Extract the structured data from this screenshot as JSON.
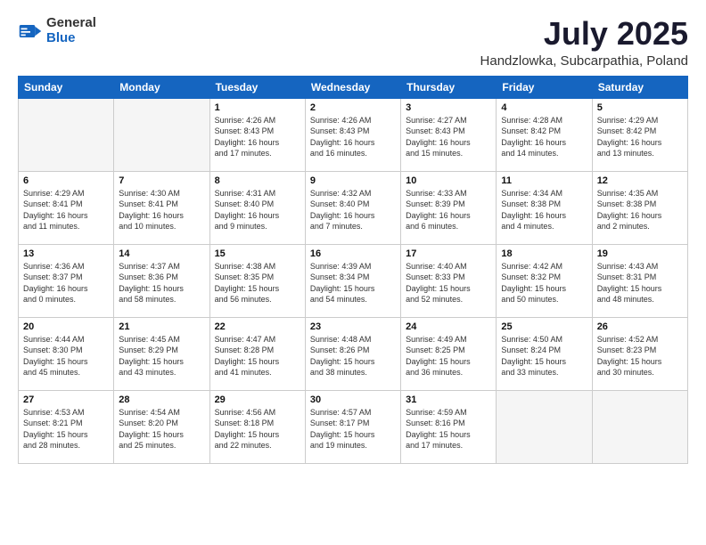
{
  "logo": {
    "general": "General",
    "blue": "Blue"
  },
  "title": "July 2025",
  "subtitle": "Handzlowka, Subcarpathia, Poland",
  "weekdays": [
    "Sunday",
    "Monday",
    "Tuesday",
    "Wednesday",
    "Thursday",
    "Friday",
    "Saturday"
  ],
  "weeks": [
    [
      {
        "day": "",
        "info": ""
      },
      {
        "day": "",
        "info": ""
      },
      {
        "day": "1",
        "info": "Sunrise: 4:26 AM\nSunset: 8:43 PM\nDaylight: 16 hours\nand 17 minutes."
      },
      {
        "day": "2",
        "info": "Sunrise: 4:26 AM\nSunset: 8:43 PM\nDaylight: 16 hours\nand 16 minutes."
      },
      {
        "day": "3",
        "info": "Sunrise: 4:27 AM\nSunset: 8:43 PM\nDaylight: 16 hours\nand 15 minutes."
      },
      {
        "day": "4",
        "info": "Sunrise: 4:28 AM\nSunset: 8:42 PM\nDaylight: 16 hours\nand 14 minutes."
      },
      {
        "day": "5",
        "info": "Sunrise: 4:29 AM\nSunset: 8:42 PM\nDaylight: 16 hours\nand 13 minutes."
      }
    ],
    [
      {
        "day": "6",
        "info": "Sunrise: 4:29 AM\nSunset: 8:41 PM\nDaylight: 16 hours\nand 11 minutes."
      },
      {
        "day": "7",
        "info": "Sunrise: 4:30 AM\nSunset: 8:41 PM\nDaylight: 16 hours\nand 10 minutes."
      },
      {
        "day": "8",
        "info": "Sunrise: 4:31 AM\nSunset: 8:40 PM\nDaylight: 16 hours\nand 9 minutes."
      },
      {
        "day": "9",
        "info": "Sunrise: 4:32 AM\nSunset: 8:40 PM\nDaylight: 16 hours\nand 7 minutes."
      },
      {
        "day": "10",
        "info": "Sunrise: 4:33 AM\nSunset: 8:39 PM\nDaylight: 16 hours\nand 6 minutes."
      },
      {
        "day": "11",
        "info": "Sunrise: 4:34 AM\nSunset: 8:38 PM\nDaylight: 16 hours\nand 4 minutes."
      },
      {
        "day": "12",
        "info": "Sunrise: 4:35 AM\nSunset: 8:38 PM\nDaylight: 16 hours\nand 2 minutes."
      }
    ],
    [
      {
        "day": "13",
        "info": "Sunrise: 4:36 AM\nSunset: 8:37 PM\nDaylight: 16 hours\nand 0 minutes."
      },
      {
        "day": "14",
        "info": "Sunrise: 4:37 AM\nSunset: 8:36 PM\nDaylight: 15 hours\nand 58 minutes."
      },
      {
        "day": "15",
        "info": "Sunrise: 4:38 AM\nSunset: 8:35 PM\nDaylight: 15 hours\nand 56 minutes."
      },
      {
        "day": "16",
        "info": "Sunrise: 4:39 AM\nSunset: 8:34 PM\nDaylight: 15 hours\nand 54 minutes."
      },
      {
        "day": "17",
        "info": "Sunrise: 4:40 AM\nSunset: 8:33 PM\nDaylight: 15 hours\nand 52 minutes."
      },
      {
        "day": "18",
        "info": "Sunrise: 4:42 AM\nSunset: 8:32 PM\nDaylight: 15 hours\nand 50 minutes."
      },
      {
        "day": "19",
        "info": "Sunrise: 4:43 AM\nSunset: 8:31 PM\nDaylight: 15 hours\nand 48 minutes."
      }
    ],
    [
      {
        "day": "20",
        "info": "Sunrise: 4:44 AM\nSunset: 8:30 PM\nDaylight: 15 hours\nand 45 minutes."
      },
      {
        "day": "21",
        "info": "Sunrise: 4:45 AM\nSunset: 8:29 PM\nDaylight: 15 hours\nand 43 minutes."
      },
      {
        "day": "22",
        "info": "Sunrise: 4:47 AM\nSunset: 8:28 PM\nDaylight: 15 hours\nand 41 minutes."
      },
      {
        "day": "23",
        "info": "Sunrise: 4:48 AM\nSunset: 8:26 PM\nDaylight: 15 hours\nand 38 minutes."
      },
      {
        "day": "24",
        "info": "Sunrise: 4:49 AM\nSunset: 8:25 PM\nDaylight: 15 hours\nand 36 minutes."
      },
      {
        "day": "25",
        "info": "Sunrise: 4:50 AM\nSunset: 8:24 PM\nDaylight: 15 hours\nand 33 minutes."
      },
      {
        "day": "26",
        "info": "Sunrise: 4:52 AM\nSunset: 8:23 PM\nDaylight: 15 hours\nand 30 minutes."
      }
    ],
    [
      {
        "day": "27",
        "info": "Sunrise: 4:53 AM\nSunset: 8:21 PM\nDaylight: 15 hours\nand 28 minutes."
      },
      {
        "day": "28",
        "info": "Sunrise: 4:54 AM\nSunset: 8:20 PM\nDaylight: 15 hours\nand 25 minutes."
      },
      {
        "day": "29",
        "info": "Sunrise: 4:56 AM\nSunset: 8:18 PM\nDaylight: 15 hours\nand 22 minutes."
      },
      {
        "day": "30",
        "info": "Sunrise: 4:57 AM\nSunset: 8:17 PM\nDaylight: 15 hours\nand 19 minutes."
      },
      {
        "day": "31",
        "info": "Sunrise: 4:59 AM\nSunset: 8:16 PM\nDaylight: 15 hours\nand 17 minutes."
      },
      {
        "day": "",
        "info": ""
      },
      {
        "day": "",
        "info": ""
      }
    ]
  ]
}
